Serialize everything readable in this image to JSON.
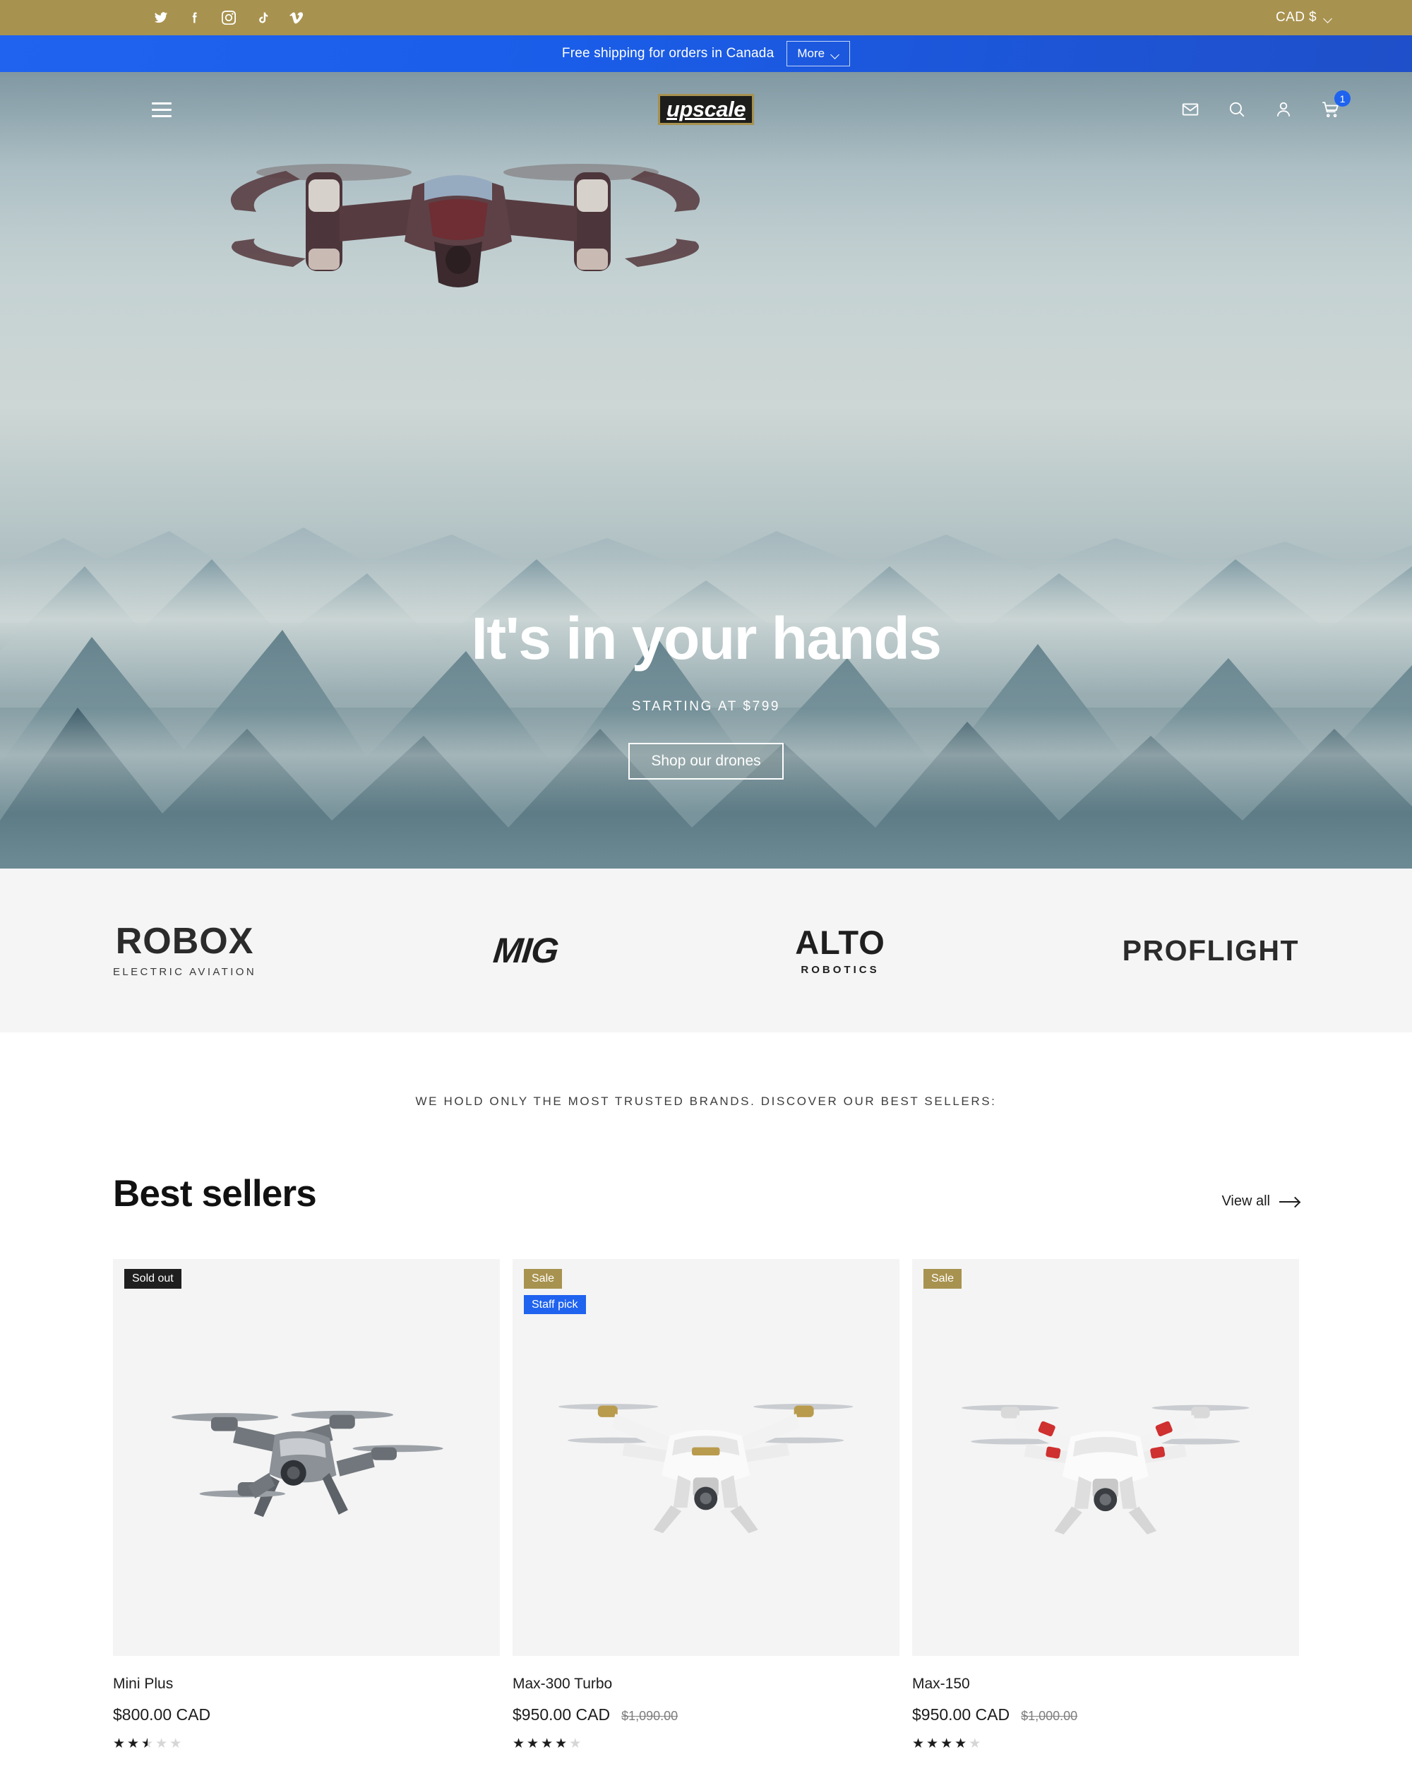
{
  "utility_bar": {
    "social": [
      {
        "name": "twitter-icon",
        "label": "Twitter"
      },
      {
        "name": "facebook-icon",
        "label": "Facebook"
      },
      {
        "name": "instagram-icon",
        "label": "Instagram"
      },
      {
        "name": "tiktok-icon",
        "label": "TikTok"
      },
      {
        "name": "vimeo-icon",
        "label": "Vimeo"
      }
    ],
    "currency": "CAD $",
    "background_color": "#a8924f"
  },
  "announcement": {
    "text": "Free shipping for orders in Canada",
    "more_label": "More",
    "background_color": "#1f63ef"
  },
  "header": {
    "logo": "upscale",
    "menu_label": "Menu",
    "icons": [
      {
        "name": "mail-icon",
        "label": "Contact"
      },
      {
        "name": "search-icon",
        "label": "Search"
      },
      {
        "name": "account-icon",
        "label": "Account"
      },
      {
        "name": "cart-icon",
        "label": "Cart"
      }
    ],
    "cart_count": "1"
  },
  "hero": {
    "title": "It's in your hands",
    "subtitle": "STARTING AT $799",
    "cta_label": "Shop our drones"
  },
  "brands": [
    {
      "name": "robox",
      "title": "ROBOX",
      "subtitle": "ELECTRIC AVIATION"
    },
    {
      "name": "mig",
      "title": "MIG",
      "subtitle": ""
    },
    {
      "name": "alto",
      "title": "ALTO",
      "subtitle": "ROBOTICS"
    },
    {
      "name": "proflight",
      "title": "PROFLIGHT",
      "subtitle": ""
    }
  ],
  "tagline": "WE HOLD ONLY THE MOST TRUSTED BRANDS. DISCOVER OUR BEST SELLERS:",
  "collection": {
    "title": "Best sellers",
    "view_all_label": "View all",
    "products": [
      {
        "title": "Mini Plus",
        "price": "$800.00 CAD",
        "compare_at": "",
        "rating": 2.5,
        "badges": [
          {
            "label": "Sold out",
            "style": "soldout"
          }
        ]
      },
      {
        "title": "Max-300 Turbo",
        "price": "$950.00 CAD",
        "compare_at": "$1,090.00",
        "rating": 4,
        "badges": [
          {
            "label": "Sale",
            "style": "sale"
          },
          {
            "label": "Staff pick",
            "style": "staff"
          }
        ]
      },
      {
        "title": "Max-150",
        "price": "$950.00 CAD",
        "compare_at": "$1,000.00",
        "rating": 4,
        "badges": [
          {
            "label": "Sale",
            "style": "sale"
          }
        ]
      }
    ]
  }
}
